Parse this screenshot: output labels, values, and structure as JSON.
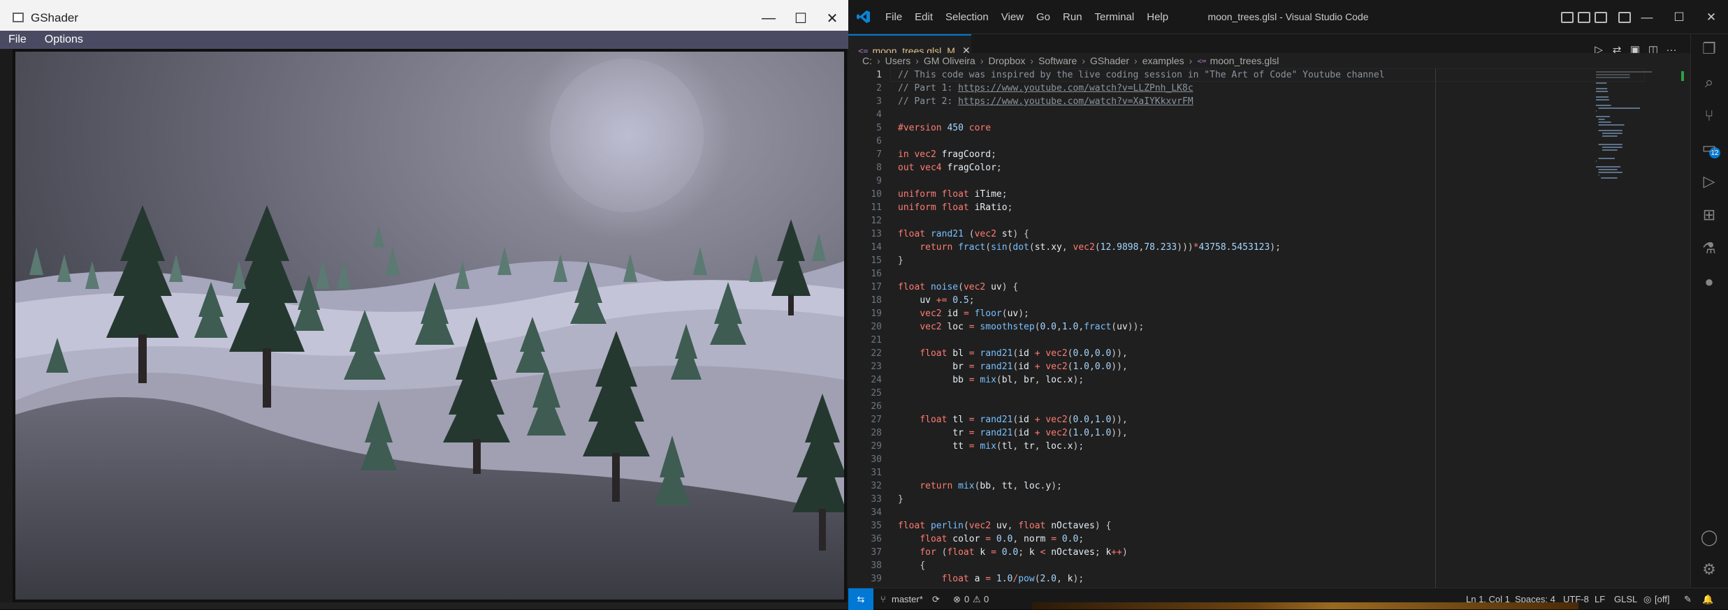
{
  "gshader": {
    "title": "GShader",
    "menu": [
      "File",
      "Options"
    ],
    "controls": {
      "minimize": "—",
      "maximize": "☐",
      "close": "✕"
    }
  },
  "vscode": {
    "menu": [
      "File",
      "Edit",
      "Selection",
      "View",
      "Go",
      "Run",
      "Terminal",
      "Help"
    ],
    "title": "moon_trees.glsl - Visual Studio Code",
    "tab": {
      "name": "moon_trees.glsl",
      "modified": "M",
      "close": "✕",
      "lang_icon": "<="
    },
    "breadcrumb": [
      "C:",
      "Users",
      "GM Oliveira",
      "Dropbox",
      "Software",
      "GShader",
      "examples",
      "moon_trees.glsl"
    ],
    "breadcrumb_file_icon": "<=",
    "source_control_badge": "12",
    "line_numbers": [
      "1",
      "2",
      "3",
      "4",
      "5",
      "6",
      "7",
      "8",
      "9",
      "10",
      "11",
      "12",
      "13",
      "14",
      "15",
      "16",
      "17",
      "18",
      "19",
      "20",
      "21",
      "22",
      "23",
      "24",
      "25",
      "26",
      "27",
      "28",
      "29",
      "30",
      "31",
      "32",
      "33",
      "34",
      "35",
      "36",
      "37",
      "38",
      "39"
    ],
    "code": [
      "// This code was inspired by the live coding session in \"The Art of Code\" Youtube channel",
      "// Part 1: https://www.youtube.com/watch?v=LLZPnh_LK8c",
      "// Part 2: https://www.youtube.com/watch?v=XaIYKkxvrFM",
      "",
      "#version 450 core",
      "",
      "in vec2 fragCoord;",
      "out vec4 fragColor;",
      "",
      "uniform float iTime;",
      "uniform float iRatio;",
      "",
      "float rand21 (vec2 st) {",
      "    return fract(sin(dot(st.xy, vec2(12.9898,78.233)))*43758.5453123);",
      "}",
      "",
      "float noise(vec2 uv) {",
      "    uv += 0.5;",
      "    vec2 id = floor(uv);",
      "    vec2 loc = smoothstep(0.0,1.0,fract(uv));",
      "",
      "    float bl = rand21(id + vec2(0.0,0.0)),",
      "          br = rand21(id + vec2(1.0,0.0)),",
      "          bb = mix(bl, br, loc.x);",
      "",
      "",
      "    float tl = rand21(id + vec2(0.0,1.0)),",
      "          tr = rand21(id + vec2(1.0,1.0)),",
      "          tt = mix(tl, tr, loc.x);",
      "",
      "",
      "    return mix(bb, tt, loc.y);",
      "}",
      "",
      "float perlin(vec2 uv, float nOctaves) {",
      "    float color = 0.0, norm = 0.0;",
      "    for (float k = 0.0; k < nOctaves; k++)",
      "    {",
      "        float a = 1.0/pow(2.0, k);"
    ],
    "status": {
      "branch": "master*",
      "errors": "0",
      "warnings": "0",
      "position": "Ln 1, Col 1",
      "spaces": "Spaces: 4",
      "encoding": "UTF-8",
      "eol": "LF",
      "language": "GLSL",
      "extra": "[off]"
    }
  },
  "colors": {
    "accent": "#0078d4",
    "tab_modified": "#e2c08d"
  }
}
